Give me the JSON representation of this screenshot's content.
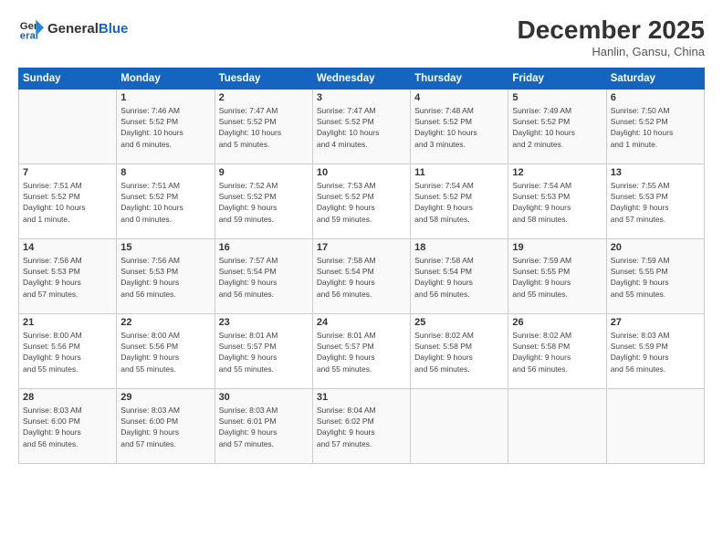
{
  "logo": {
    "line1": "General",
    "line2": "Blue"
  },
  "title": "December 2025",
  "subtitle": "Hanlin, Gansu, China",
  "header_days": [
    "Sunday",
    "Monday",
    "Tuesday",
    "Wednesday",
    "Thursday",
    "Friday",
    "Saturday"
  ],
  "weeks": [
    [
      {
        "num": "",
        "info": ""
      },
      {
        "num": "1",
        "info": "Sunrise: 7:46 AM\nSunset: 5:52 PM\nDaylight: 10 hours\nand 6 minutes."
      },
      {
        "num": "2",
        "info": "Sunrise: 7:47 AM\nSunset: 5:52 PM\nDaylight: 10 hours\nand 5 minutes."
      },
      {
        "num": "3",
        "info": "Sunrise: 7:47 AM\nSunset: 5:52 PM\nDaylight: 10 hours\nand 4 minutes."
      },
      {
        "num": "4",
        "info": "Sunrise: 7:48 AM\nSunset: 5:52 PM\nDaylight: 10 hours\nand 3 minutes."
      },
      {
        "num": "5",
        "info": "Sunrise: 7:49 AM\nSunset: 5:52 PM\nDaylight: 10 hours\nand 2 minutes."
      },
      {
        "num": "6",
        "info": "Sunrise: 7:50 AM\nSunset: 5:52 PM\nDaylight: 10 hours\nand 1 minute."
      }
    ],
    [
      {
        "num": "7",
        "info": "Sunrise: 7:51 AM\nSunset: 5:52 PM\nDaylight: 10 hours\nand 1 minute."
      },
      {
        "num": "8",
        "info": "Sunrise: 7:51 AM\nSunset: 5:52 PM\nDaylight: 10 hours\nand 0 minutes."
      },
      {
        "num": "9",
        "info": "Sunrise: 7:52 AM\nSunset: 5:52 PM\nDaylight: 9 hours\nand 59 minutes."
      },
      {
        "num": "10",
        "info": "Sunrise: 7:53 AM\nSunset: 5:52 PM\nDaylight: 9 hours\nand 59 minutes."
      },
      {
        "num": "11",
        "info": "Sunrise: 7:54 AM\nSunset: 5:52 PM\nDaylight: 9 hours\nand 58 minutes."
      },
      {
        "num": "12",
        "info": "Sunrise: 7:54 AM\nSunset: 5:53 PM\nDaylight: 9 hours\nand 58 minutes."
      },
      {
        "num": "13",
        "info": "Sunrise: 7:55 AM\nSunset: 5:53 PM\nDaylight: 9 hours\nand 57 minutes."
      }
    ],
    [
      {
        "num": "14",
        "info": "Sunrise: 7:56 AM\nSunset: 5:53 PM\nDaylight: 9 hours\nand 57 minutes."
      },
      {
        "num": "15",
        "info": "Sunrise: 7:56 AM\nSunset: 5:53 PM\nDaylight: 9 hours\nand 56 minutes."
      },
      {
        "num": "16",
        "info": "Sunrise: 7:57 AM\nSunset: 5:54 PM\nDaylight: 9 hours\nand 56 minutes."
      },
      {
        "num": "17",
        "info": "Sunrise: 7:58 AM\nSunset: 5:54 PM\nDaylight: 9 hours\nand 56 minutes."
      },
      {
        "num": "18",
        "info": "Sunrise: 7:58 AM\nSunset: 5:54 PM\nDaylight: 9 hours\nand 56 minutes."
      },
      {
        "num": "19",
        "info": "Sunrise: 7:59 AM\nSunset: 5:55 PM\nDaylight: 9 hours\nand 55 minutes."
      },
      {
        "num": "20",
        "info": "Sunrise: 7:59 AM\nSunset: 5:55 PM\nDaylight: 9 hours\nand 55 minutes."
      }
    ],
    [
      {
        "num": "21",
        "info": "Sunrise: 8:00 AM\nSunset: 5:56 PM\nDaylight: 9 hours\nand 55 minutes."
      },
      {
        "num": "22",
        "info": "Sunrise: 8:00 AM\nSunset: 5:56 PM\nDaylight: 9 hours\nand 55 minutes."
      },
      {
        "num": "23",
        "info": "Sunrise: 8:01 AM\nSunset: 5:57 PM\nDaylight: 9 hours\nand 55 minutes."
      },
      {
        "num": "24",
        "info": "Sunrise: 8:01 AM\nSunset: 5:57 PM\nDaylight: 9 hours\nand 55 minutes."
      },
      {
        "num": "25",
        "info": "Sunrise: 8:02 AM\nSunset: 5:58 PM\nDaylight: 9 hours\nand 56 minutes."
      },
      {
        "num": "26",
        "info": "Sunrise: 8:02 AM\nSunset: 5:58 PM\nDaylight: 9 hours\nand 56 minutes."
      },
      {
        "num": "27",
        "info": "Sunrise: 8:03 AM\nSunset: 5:59 PM\nDaylight: 9 hours\nand 56 minutes."
      }
    ],
    [
      {
        "num": "28",
        "info": "Sunrise: 8:03 AM\nSunset: 6:00 PM\nDaylight: 9 hours\nand 56 minutes."
      },
      {
        "num": "29",
        "info": "Sunrise: 8:03 AM\nSunset: 6:00 PM\nDaylight: 9 hours\nand 57 minutes."
      },
      {
        "num": "30",
        "info": "Sunrise: 8:03 AM\nSunset: 6:01 PM\nDaylight: 9 hours\nand 57 minutes."
      },
      {
        "num": "31",
        "info": "Sunrise: 8:04 AM\nSunset: 6:02 PM\nDaylight: 9 hours\nand 57 minutes."
      },
      {
        "num": "",
        "info": ""
      },
      {
        "num": "",
        "info": ""
      },
      {
        "num": "",
        "info": ""
      }
    ]
  ]
}
